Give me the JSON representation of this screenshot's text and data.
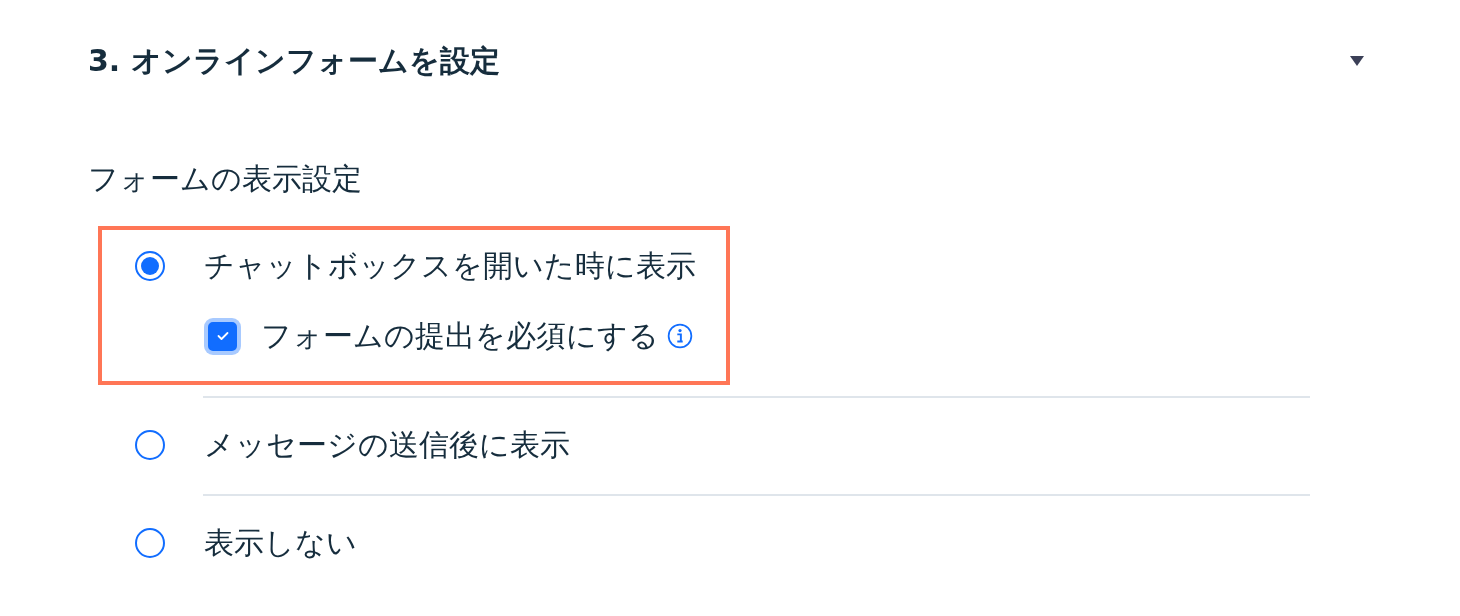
{
  "section": {
    "title": "3. オンラインフォームを設定",
    "expanded": true
  },
  "subtitle": "フォームの表示設定",
  "options": [
    {
      "label": "チャットボックスを開いた時に表示",
      "selected": true,
      "highlighted": true,
      "suboptions": [
        {
          "label": "フォームの提出を必須にする",
          "checked": true,
          "info": true
        }
      ]
    },
    {
      "label": "メッセージの送信後に表示",
      "selected": false,
      "highlighted": false
    },
    {
      "label": "表示しない",
      "selected": false,
      "highlighted": false
    }
  ]
}
